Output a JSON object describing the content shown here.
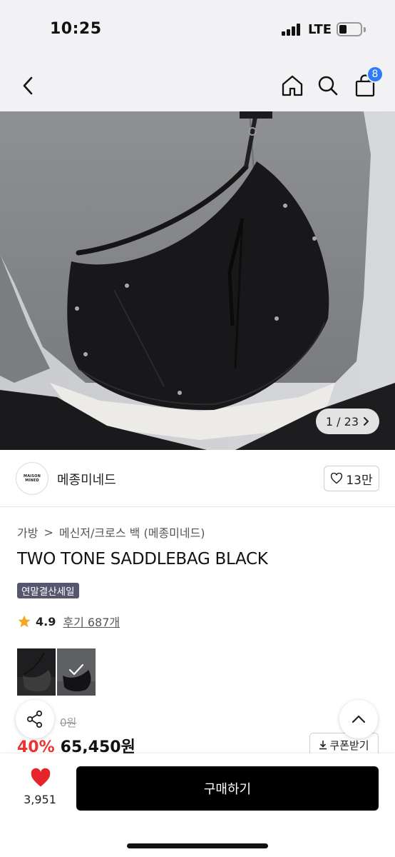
{
  "status_bar": {
    "time": "10:25",
    "network": "LTE"
  },
  "nav": {
    "back_icon": "chevron-left-icon",
    "home_icon": "home-icon",
    "search_icon": "search-icon",
    "cart_icon": "shopping-bag-icon",
    "cart_count": "8"
  },
  "image_gallery": {
    "counter": "1 / 23"
  },
  "brand": {
    "logo_text": "MAISON MINED",
    "name": "메종미네드",
    "like_count": "13만"
  },
  "breadcrumb": {
    "category": "가방",
    "separator": ">",
    "subcategory": "메신저/크로스 백 (메종미네드)"
  },
  "product": {
    "title": "TWO TONE SADDLEBAG BLACK",
    "badge": "연말결산세일",
    "rating": "4.9",
    "review_link": "후기 687개",
    "original_price": "0원",
    "discount": "40%",
    "price": "65,450원"
  },
  "actions": {
    "coupon_label": "쿠폰받기",
    "wish_count": "3,951",
    "buy_label": "구매하기"
  },
  "colors": {
    "accent_blue": "#2f7cf6",
    "discount_red": "#e33333",
    "badge_purple": "#57566f",
    "heart_red": "#e4262c",
    "star": "#f5a623"
  }
}
